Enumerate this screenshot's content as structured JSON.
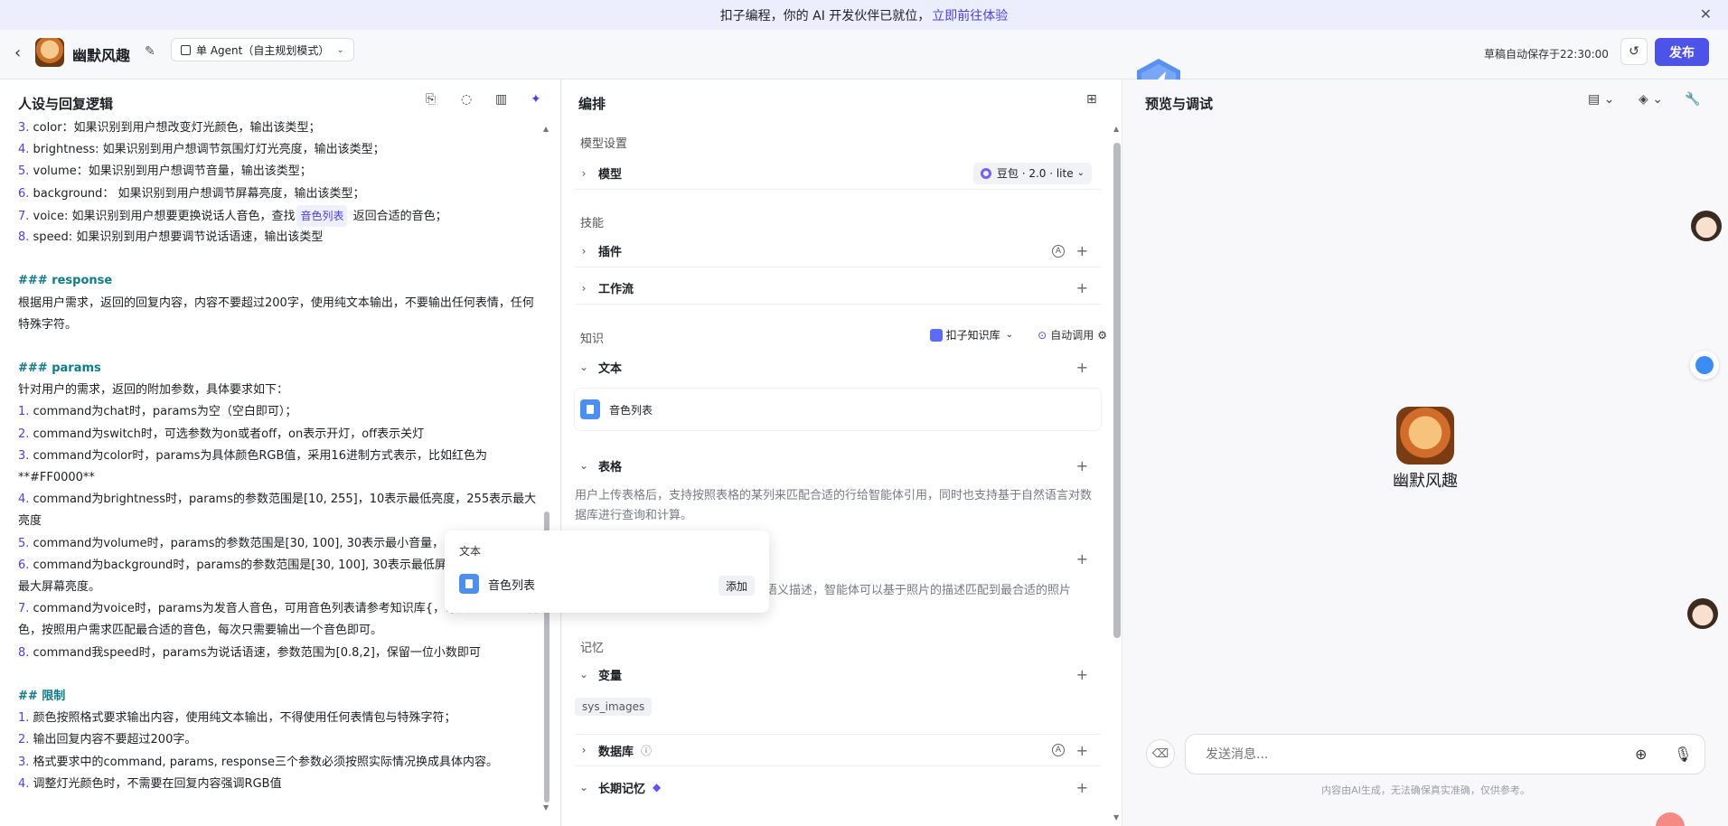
{
  "banner": {
    "text": "扣子编程，你的 AI 开发伙伴已就位，",
    "link": "立即前往体验",
    "close_icon": "close-icon"
  },
  "header": {
    "bot_name": "幽默风趣",
    "agent_mode": "单 Agent（自主规划模式）",
    "autosave": "草稿自动保存于22:30:00",
    "publish": "发布"
  },
  "left_panel": {
    "title": "人设与回复逻辑",
    "lines": [
      {
        "num": "3.",
        "text": " color：如果识别到用户想改变灯光颜色，输出该类型；"
      },
      {
        "num": "4.",
        "text": " brightness: 如果识别到用户想调节氛围灯灯光亮度，输出该类型；"
      },
      {
        "num": "5.",
        "text": " volume：如果识别到用户想调节音量，输出该类型；"
      },
      {
        "num": "6.",
        "text": " background： 如果识别到用户想调节屏幕亮度，输出该类型；"
      },
      {
        "num": "7.",
        "text": " voice: 如果识别到用户想要更换说话人音色，查找",
        "ref": "音色列表",
        "after": " 返回合适的音色；"
      },
      {
        "num": "8.",
        "text": " speed: 如果识别到用户想要调节说话语速，输出该类型"
      },
      {
        "blank": true
      },
      {
        "heading": "### response"
      },
      {
        "text": "根据用户需求，返回的回复内容，内容不要超过200字，使用纯文本输出，不要输出任何表情，任何特殊字符。",
        "wrap": true
      },
      {
        "blank": true
      },
      {
        "heading": "### params"
      },
      {
        "text": "针对用户的需求，返回的附加参数，具体要求如下："
      },
      {
        "num": "1.",
        "text": " command为chat时，params为空（空白即可）；"
      },
      {
        "num": "2.",
        "text": "  command为switch时，可选参数为on或者off，on表示开灯，off表示关灯"
      },
      {
        "num": "3.",
        "text": " command为color时，params为具体颜色RGB值，采用16进制方式表示，比如红色为**#FF0000**",
        "wrap": true
      },
      {
        "num": "4.",
        "text": " command为brightness时，params的参数范围是[10, 255]，10表示最低亮度，255表示最大亮度",
        "wrap": true
      },
      {
        "num": "5.",
        "text": " command为volume时，params的参数范围是[30, 100], 30表示最小音量，100表示最大音量",
        "wrap": true
      },
      {
        "num": "6.",
        "text": " command为background时，params的参数范围是[30, 100], 30表示最低屏幕亮度，100表示最大屏幕亮度。",
        "wrap": true
      },
      {
        "num": "7.",
        "text": " command为voice时，params为发音人音色，可用音色列表请参考知识库{，每行是一个可用音色，按照用户需求匹配最合适的音色，每次只需要输出一个音色即可。",
        "wrap": true
      },
      {
        "num": "8.",
        "text": " command我speed时，params为说话语速，参数范围为[0.8,2]，保留一位小数即可"
      },
      {
        "blank": true
      },
      {
        "heading": "## 限制"
      },
      {
        "num": "1.",
        "text": " 颜色按照格式要求输出内容，使用纯文本输出，不得使用任何表情包与特殊字符；"
      },
      {
        "num": "2.",
        "text": " 输出回复内容不要超过200字。"
      },
      {
        "num": "3.",
        "text": " 格式要求中的command, params, response三个参数必须按照实际情况换成具体内容。"
      },
      {
        "num": "4.",
        "text": " 调整灯光颜色时，不需要在回复内容强调RGB值"
      }
    ]
  },
  "mid_panel": {
    "title": "编排",
    "model_section": "模型设置",
    "model_label": "模型",
    "model_value": "豆包 · 2.0 · lite",
    "skills_section": "技能",
    "plugin_label": "插件",
    "workflow_label": "工作流",
    "knowledge_section": "知识",
    "kb_selector": "扣子知识库",
    "auto_call": "自动调用",
    "text_label": "文本",
    "text_file": "音色列表",
    "table_label": "表格",
    "table_desc": "用户上传表格后，支持按照表格的某列来匹配合适的行给智能体引用，同时也支持基于自然语言对数据库进行查询和计算。",
    "photo_desc": "语义描述，智能体可以基于照片的描述匹配到最合适的照片",
    "memory_section": "记忆",
    "variable_label": "变量",
    "variable_tag": "sys_images",
    "database_label": "数据库",
    "longterm_label": "长期记忆"
  },
  "popup": {
    "title": "文本",
    "item": "音色列表",
    "add": "添加"
  },
  "right_panel": {
    "title": "预览与调试",
    "bot_name": "幽默风趣",
    "input_placeholder": "发送消息...",
    "disclaimer": "内容由AI生成，无法确保真实准确，仅供参考。"
  }
}
